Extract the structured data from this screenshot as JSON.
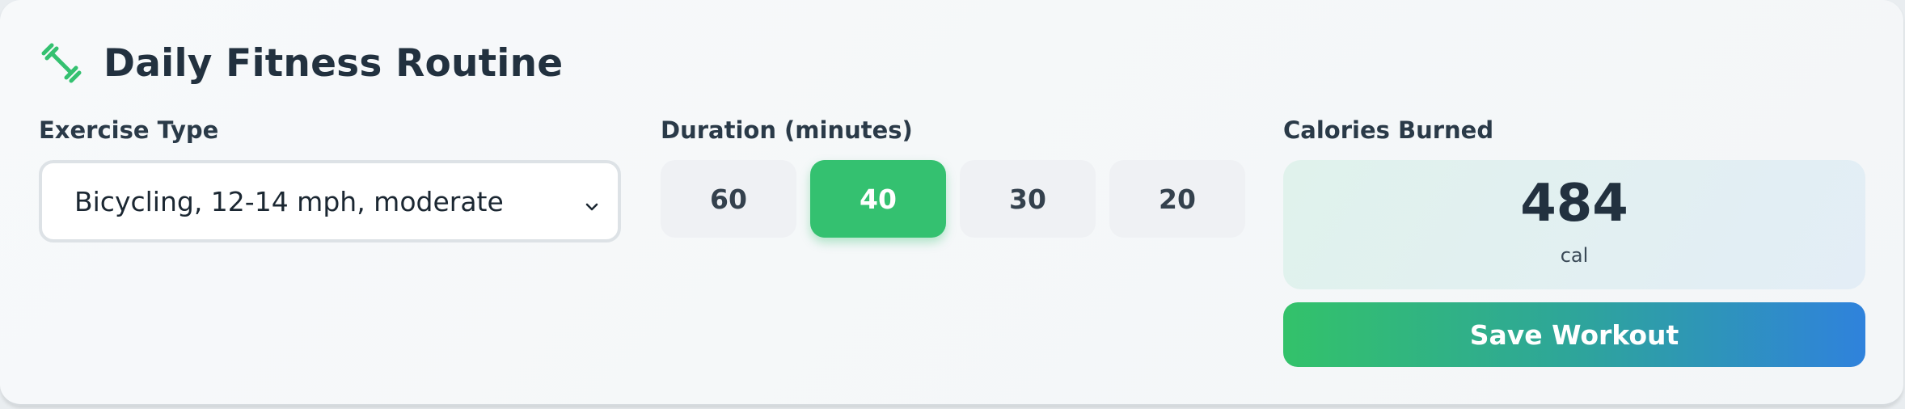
{
  "header": {
    "title": "Daily Fitness Routine",
    "icon": "dumbbell-icon"
  },
  "exercise": {
    "label": "Exercise Type",
    "selected": "Bicycling, 12-14 mph, moderate"
  },
  "duration": {
    "label": "Duration (minutes)",
    "options": [
      "60",
      "40",
      "30",
      "20"
    ],
    "selected": "40"
  },
  "calories": {
    "label": "Calories Burned",
    "value": "484",
    "unit": "cal"
  },
  "actions": {
    "save_label": "Save Workout"
  },
  "colors": {
    "accent": "#34c170",
    "gradient_end": "#2f82dc",
    "title": "#22313f"
  }
}
